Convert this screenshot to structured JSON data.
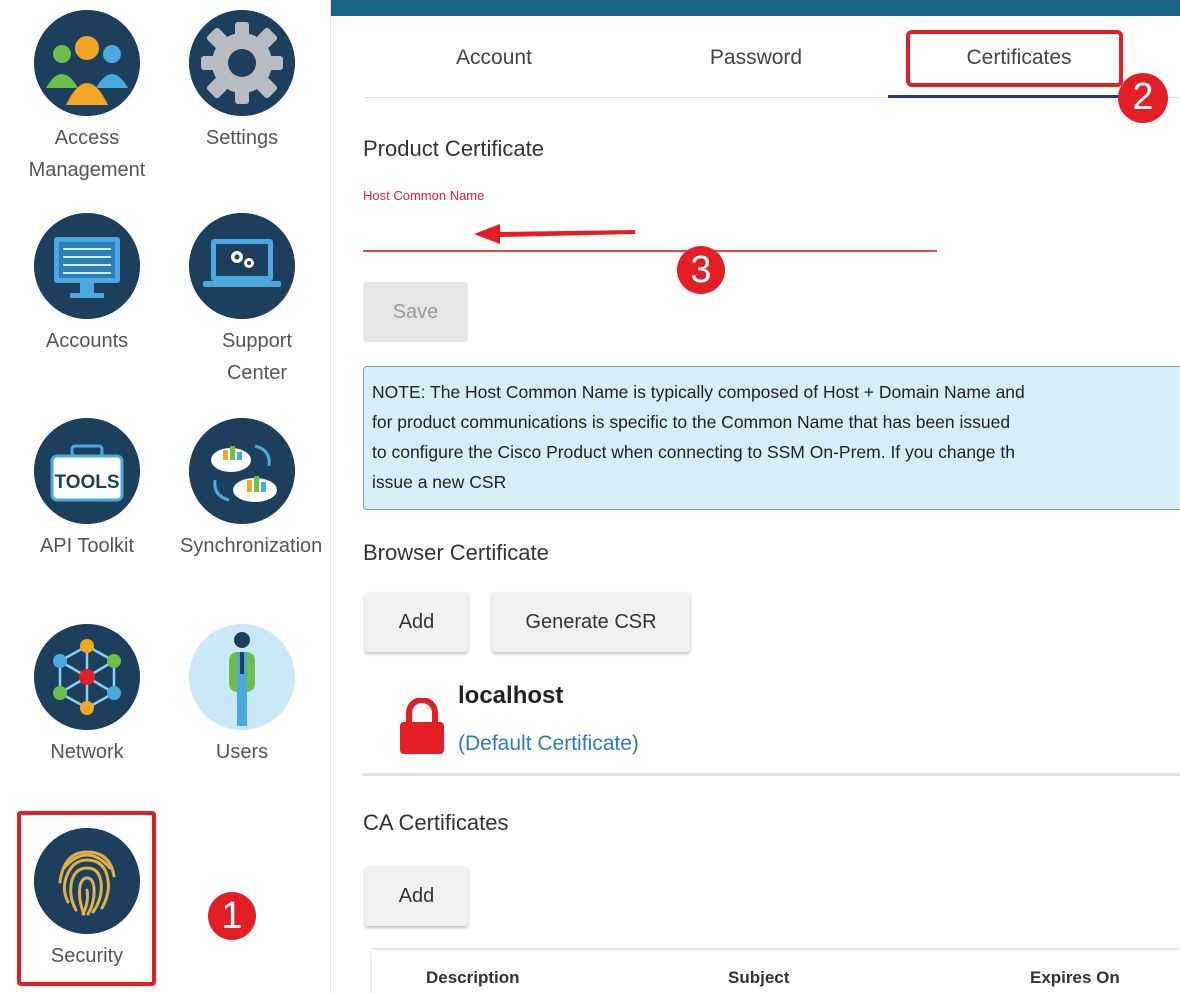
{
  "sidebar": {
    "tiles": [
      {
        "label": "Access\nManagement",
        "icon": "people-group-icon"
      },
      {
        "label": "Settings",
        "icon": "gear-icon"
      },
      {
        "label": "Accounts",
        "icon": "monitor-icon"
      },
      {
        "label": "Support\nCenter",
        "icon": "laptop-gears-icon"
      },
      {
        "label": "API Toolkit",
        "icon": "toolbox-icon"
      },
      {
        "label": "Synchronization",
        "icon": "cloud-sync-icon"
      },
      {
        "label": "Network",
        "icon": "network-icon"
      },
      {
        "label": "Users",
        "icon": "user-icon"
      },
      {
        "label": "Security",
        "icon": "fingerprint-icon"
      }
    ]
  },
  "tabs": [
    "Account",
    "Password",
    "Certificates"
  ],
  "active_tab": "Certificates",
  "product_certificate": {
    "heading": "Product Certificate",
    "field_label": "Host Common Name",
    "field_value": "",
    "save_label": "Save"
  },
  "note": {
    "line1": "NOTE: The Host Common Name is typically composed of Host + Domain Name and",
    "line2": "for product communications is specific to the Common Name that has been issued",
    "line3": "to configure the Cisco Product when connecting to SSM On-Prem. If you change th",
    "line4": "issue a new CSR"
  },
  "browser_certificate": {
    "heading": "Browser Certificate",
    "add_label": "Add",
    "generate_label": "Generate CSR",
    "cert_name": "localhost",
    "cert_sub": "(Default Certificate)"
  },
  "ca_certificates": {
    "heading": "CA Certificates",
    "add_label": "Add",
    "columns": [
      "Description",
      "Subject",
      "Expires On"
    ]
  },
  "annotations": {
    "step1": "1",
    "step2": "2",
    "step3": "3"
  },
  "colors": {
    "accent_red": "#e31e24",
    "topbar": "#196688",
    "tab_underline": "#23378f",
    "icon_navy": "#1d3f5e"
  }
}
